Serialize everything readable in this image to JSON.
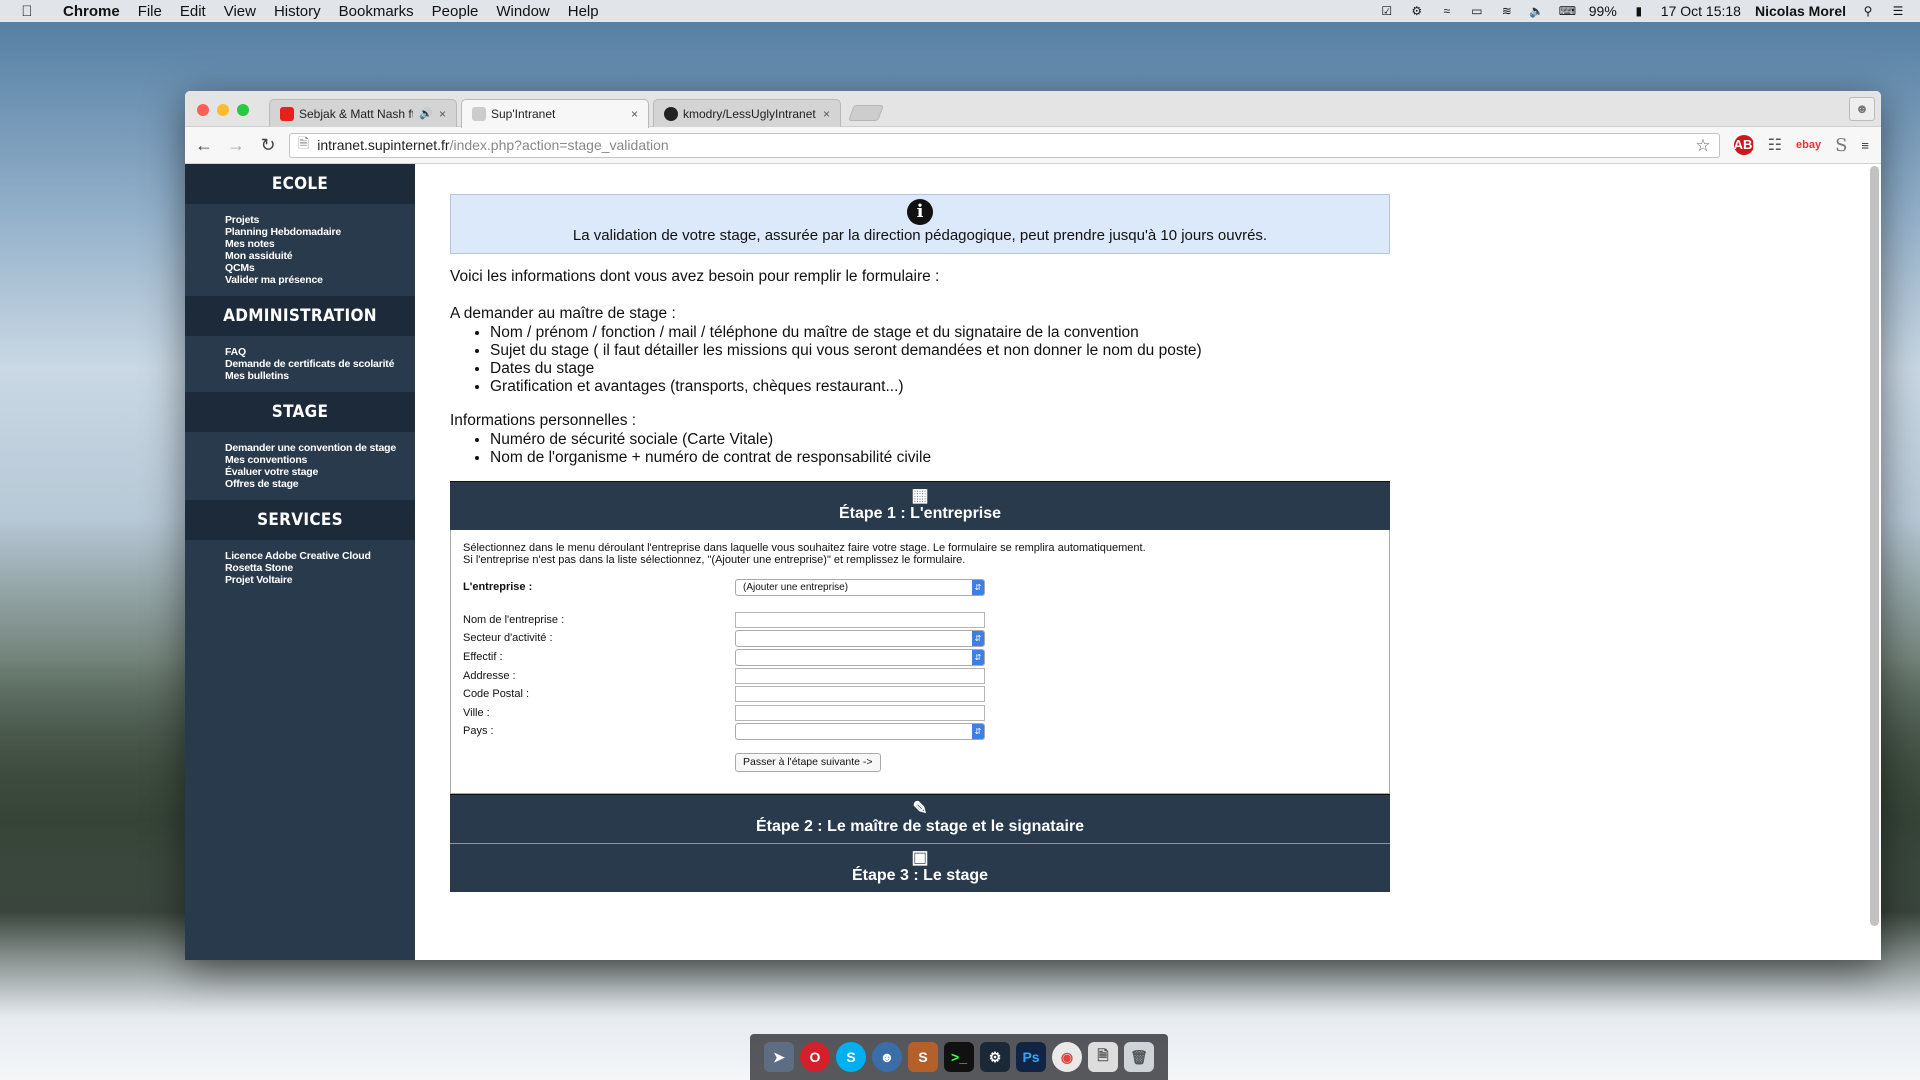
{
  "menubar": {
    "app": "Chrome",
    "items": [
      "File",
      "Edit",
      "View",
      "History",
      "Bookmarks",
      "People",
      "Window",
      "Help"
    ],
    "battery": "99%",
    "datetime": "17 Oct  15:18",
    "user": "Nicolas Morel"
  },
  "tabs": [
    {
      "title": "Sebjak & Matt Nash ft.",
      "favicon_color": "#e62117"
    },
    {
      "title": "Sup'Intranet",
      "favicon_color": "#bbbbbb"
    },
    {
      "title": "kmodry/LessUglyIntranet",
      "favicon_color": "#222222"
    }
  ],
  "address": {
    "host": "intranet.supinternet.fr",
    "path": "/index.php?action=stage_validation"
  },
  "ext": {
    "abp": "ABP",
    "ebay": "ebay",
    "s": "S"
  },
  "sidebar": [
    {
      "title": "ECOLE",
      "links": [
        "Projets",
        "Planning Hebdomadaire",
        "Mes notes",
        "Mon assiduité",
        "QCMs",
        "Valider ma présence"
      ]
    },
    {
      "title": "ADMINISTRATION",
      "links": [
        "FAQ",
        "Demande de certificats de scolarité",
        "Mes bulletins"
      ]
    },
    {
      "title": "STAGE",
      "links": [
        "Demander une convention de stage",
        "Mes conventions",
        "Évaluer votre stage",
        "Offres de stage"
      ]
    },
    {
      "title": "SERVICES",
      "links": [
        "Licence Adobe Creative Cloud",
        "Rosetta Stone",
        "Projet Voltaire"
      ]
    }
  ],
  "main": {
    "info": "La validation de votre stage, assurée par la direction pédagogique, peut prendre jusqu'à 10 jours ouvrés.",
    "intro": "Voici les informations dont vous avez besoin pour remplir le formulaire :",
    "ask_title": "A demander au maître de stage :",
    "ask_items": [
      "Nom / prénom / fonction / mail / téléphone du maître de stage et du signataire de la convention",
      "Sujet du stage ( il faut détailler les missions qui vous seront demandées et non donner le nom du poste)",
      "Dates du stage",
      "Gratification et avantages (transports, chèques restaurant...)"
    ],
    "perso_title": "Informations personnelles :",
    "perso_items": [
      "Numéro de sécurité sociale (Carte Vitale)",
      "Nom de l'organisme + numéro de contrat de responsabilité civile"
    ]
  },
  "step1": {
    "title": "Étape 1 : L'entreprise",
    "desc1": "Sélectionnez dans le menu déroulant l'entreprise dans laquelle vous souhaitez faire votre stage. Le formulaire se remplira automatiquement.",
    "desc2": "Si l'entreprise n'est pas dans la liste sélectionnez, \"(Ajouter une entreprise)\" et remplissez le formulaire.",
    "company_label": "L'entreprise :",
    "company_value": "(Ajouter une entreprise)",
    "labels": {
      "nom": "Nom de l'entreprise :",
      "secteur": "Secteur d'activité :",
      "effectif": "Effectif :",
      "adresse": "Addresse :",
      "cp": "Code Postal :",
      "ville": "Ville :",
      "pays": "Pays :"
    },
    "next_button": "Passer à l'étape suivante ->"
  },
  "step2": {
    "title": "Étape 2 : Le maître de stage et le signataire"
  },
  "step3": {
    "title": "Étape 3 : Le stage"
  }
}
